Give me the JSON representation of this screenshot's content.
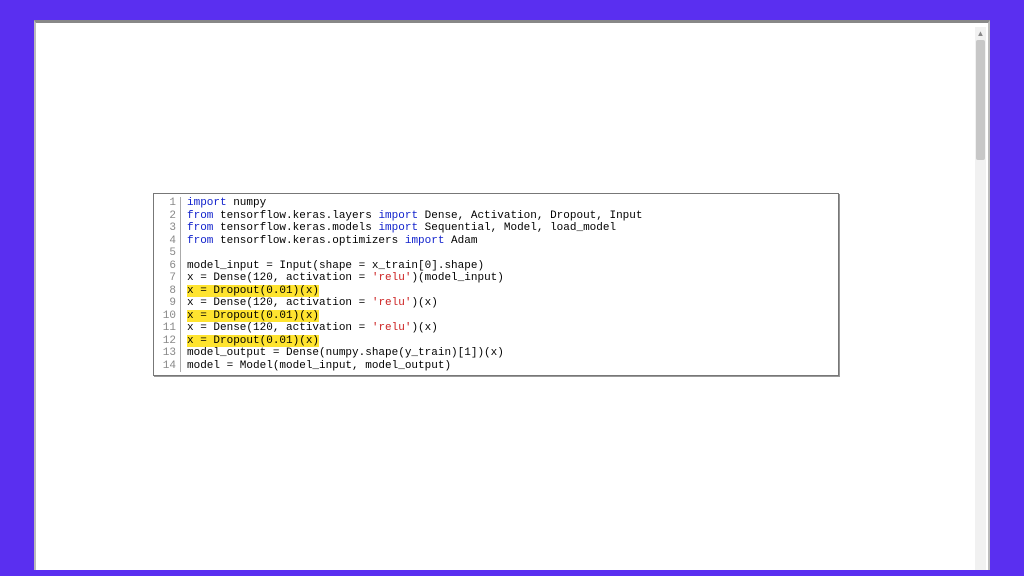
{
  "code": {
    "lines": [
      {
        "n": 1,
        "hl": false,
        "tokens": [
          {
            "t": "import",
            "c": "kw"
          },
          {
            "t": " numpy"
          }
        ]
      },
      {
        "n": 2,
        "hl": false,
        "tokens": [
          {
            "t": "from",
            "c": "kw"
          },
          {
            "t": " tensorflow.keras.layers "
          },
          {
            "t": "import",
            "c": "kw"
          },
          {
            "t": " Dense, Activation, Dropout, Input"
          }
        ]
      },
      {
        "n": 3,
        "hl": false,
        "tokens": [
          {
            "t": "from",
            "c": "kw"
          },
          {
            "t": " tensorflow.keras.models "
          },
          {
            "t": "import",
            "c": "kw"
          },
          {
            "t": " Sequential, Model, load_model"
          }
        ]
      },
      {
        "n": 4,
        "hl": false,
        "tokens": [
          {
            "t": "from",
            "c": "kw"
          },
          {
            "t": " tensorflow.keras.optimizers "
          },
          {
            "t": "import",
            "c": "kw"
          },
          {
            "t": " Adam"
          }
        ]
      },
      {
        "n": 5,
        "hl": false,
        "tokens": [
          {
            "t": ""
          }
        ]
      },
      {
        "n": 6,
        "hl": false,
        "tokens": [
          {
            "t": "model_input = Input(shape = x_train[0].shape)"
          }
        ]
      },
      {
        "n": 7,
        "hl": false,
        "tokens": [
          {
            "t": "x = Dense(120, activation = "
          },
          {
            "t": "'relu'",
            "c": "str"
          },
          {
            "t": ")(model_input)"
          }
        ]
      },
      {
        "n": 8,
        "hl": true,
        "tokens": [
          {
            "t": "x = Dropout(0.01)(x)"
          }
        ]
      },
      {
        "n": 9,
        "hl": false,
        "tokens": [
          {
            "t": "x = Dense(120, activation = "
          },
          {
            "t": "'relu'",
            "c": "str"
          },
          {
            "t": ")(x)"
          }
        ]
      },
      {
        "n": 10,
        "hl": true,
        "tokens": [
          {
            "t": "x = Dropout(0.01)(x)"
          }
        ]
      },
      {
        "n": 11,
        "hl": false,
        "tokens": [
          {
            "t": "x = Dense(120, activation = "
          },
          {
            "t": "'relu'",
            "c": "str"
          },
          {
            "t": ")(x)"
          }
        ]
      },
      {
        "n": 12,
        "hl": true,
        "tokens": [
          {
            "t": "x = Dropout(0.01)(x)"
          }
        ]
      },
      {
        "n": 13,
        "hl": false,
        "tokens": [
          {
            "t": "model_output = Dense(numpy.shape(y_train)[1])(x)"
          }
        ]
      },
      {
        "n": 14,
        "hl": false,
        "tokens": [
          {
            "t": "model = Model(model_input, model_output)"
          }
        ]
      }
    ]
  }
}
